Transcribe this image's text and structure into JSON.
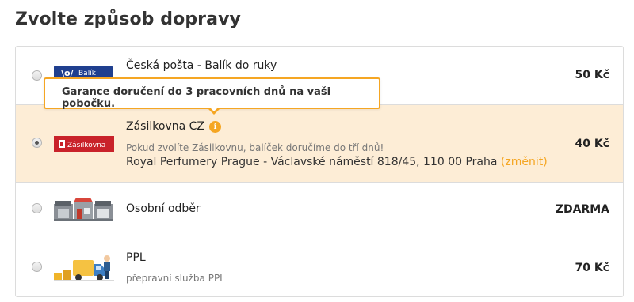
{
  "page": {
    "title": "Zvolte způsob dopravy"
  },
  "tooltip": {
    "text": "Garance doručení do 3 pracovních dnů na vaši pobočku."
  },
  "options": [
    {
      "name": "Česká pošta - Balík do ruky",
      "price": "50 Kč",
      "logo_text": "Balík",
      "selected": false
    },
    {
      "name": "Zásilkovna CZ",
      "info_icon": "i",
      "description": "Pokud zvolíte Zásilkovnu, balíček doručíme do tří dnů!",
      "address": "Royal Perfumery Prague - Václavské náměstí 818/45, 110 00 Praha",
      "change_link": "(změnit)",
      "logo_text": "Zásilkovna",
      "price": "40 Kč",
      "selected": true
    },
    {
      "name": "Osobní odběr",
      "price": "ZDARMA",
      "selected": false
    },
    {
      "name": "PPL",
      "description": "přepravní služba PPL",
      "price": "70 Kč",
      "selected": false
    }
  ],
  "colors": {
    "accent": "#f5a623",
    "selected_bg": "#fdedd6",
    "zasilkovna_red": "#c9222a",
    "posta_blue": "#1f3f8f"
  }
}
